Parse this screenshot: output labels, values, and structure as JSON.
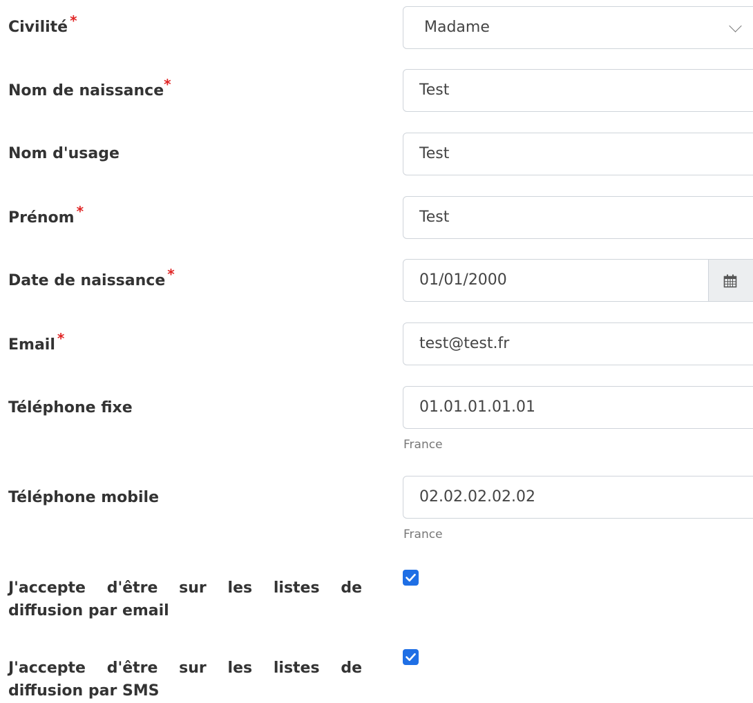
{
  "form": {
    "civilite": {
      "label": "Civilité",
      "required_mark": "*",
      "value": "Madame"
    },
    "nom_naissance": {
      "label": "Nom de naissance",
      "required_mark": "*",
      "value": "Test"
    },
    "nom_usage": {
      "label": "Nom d'usage",
      "value": "Test"
    },
    "prenom": {
      "label": "Prénom",
      "required_mark": "*",
      "value": "Test"
    },
    "date_naissance": {
      "label": "Date de naissance",
      "required_mark": "*",
      "value": "01/01/2000"
    },
    "email": {
      "label": "Email",
      "required_mark": "*",
      "value": "test@test.fr"
    },
    "tel_fixe": {
      "label": "Téléphone fixe",
      "value": "01.01.01.01.01",
      "country": "France"
    },
    "tel_mobile": {
      "label": "Téléphone mobile",
      "value": "02.02.02.02.02",
      "country": "France"
    },
    "optin_email": {
      "label": "J'accepte d'être sur les listes de diffusion par email",
      "checked": true
    },
    "optin_sms": {
      "label": "J'accepte d'être sur les listes de diffusion par SMS",
      "checked": true
    }
  },
  "colors": {
    "required": "#e02424",
    "checkbox": "#1f6fe5",
    "border": "#cfd4da",
    "addon_bg": "#eceef0"
  },
  "icons": {
    "select": "chevron-down-icon",
    "date": "calendar-icon",
    "checked": "checkmark-icon"
  }
}
